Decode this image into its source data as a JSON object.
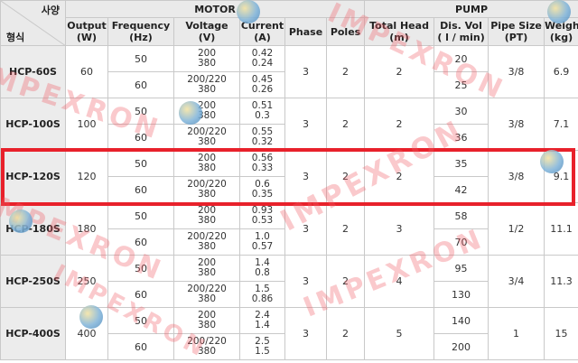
{
  "header": {
    "corner_top": "사양",
    "corner_bottom": "형식",
    "motor_group": "MOTOR",
    "pump_group": "PUMP",
    "output": [
      "Output",
      "(W)"
    ],
    "frequency": [
      "Frequency",
      "(Hz)"
    ],
    "voltage": [
      "Voltage",
      "(V)"
    ],
    "current": [
      "Current",
      "(A)"
    ],
    "phase": "Phase",
    "poles": "Poles",
    "total_head": [
      "Total Head",
      "(m)"
    ],
    "dis_vol": [
      "Dis. Vol",
      "( l / min)"
    ],
    "pipe_size": [
      "Pipe Size",
      "(PT)"
    ],
    "weight": [
      "Weight",
      "(kg)"
    ]
  },
  "rows": [
    {
      "model": "HCP-60S",
      "output": "60",
      "phase": "3",
      "poles": "2",
      "head": "2",
      "pipe": "3/8",
      "weight": "6.9",
      "sub": [
        {
          "hz": "50",
          "v": [
            "200",
            "380"
          ],
          "a": [
            "0.42",
            "0.24"
          ],
          "vol": "20"
        },
        {
          "hz": "60",
          "v": [
            "200/220",
            "380"
          ],
          "a": [
            "0.45",
            "0.26"
          ],
          "vol": "25"
        }
      ]
    },
    {
      "model": "HCP-100S",
      "output": "100",
      "phase": "3",
      "poles": "2",
      "head": "2",
      "pipe": "3/8",
      "weight": "7.1",
      "sub": [
        {
          "hz": "50",
          "v": [
            "200",
            "380"
          ],
          "a": [
            "0.51",
            "0.3"
          ],
          "vol": "30"
        },
        {
          "hz": "60",
          "v": [
            "200/220",
            "380"
          ],
          "a": [
            "0.55",
            "0.32"
          ],
          "vol": "36"
        }
      ]
    },
    {
      "model": "HCP-120S",
      "output": "120",
      "phase": "3",
      "poles": "2",
      "head": "2",
      "pipe": "3/8",
      "weight": "9.1",
      "sub": [
        {
          "hz": "50",
          "v": [
            "200",
            "380"
          ],
          "a": [
            "0.56",
            "0.33"
          ],
          "vol": "35"
        },
        {
          "hz": "60",
          "v": [
            "200/220",
            "380"
          ],
          "a": [
            "0.6",
            "0.35"
          ],
          "vol": "42"
        }
      ]
    },
    {
      "model": "HCP-180S",
      "output": "180",
      "phase": "3",
      "poles": "2",
      "head": "3",
      "pipe": "1/2",
      "weight": "11.1",
      "sub": [
        {
          "hz": "50",
          "v": [
            "200",
            "380"
          ],
          "a": [
            "0.93",
            "0.53"
          ],
          "vol": "58"
        },
        {
          "hz": "60",
          "v": [
            "200/220",
            "380"
          ],
          "a": [
            "1.0",
            "0.57"
          ],
          "vol": "70"
        }
      ]
    },
    {
      "model": "HCP-250S",
      "output": "250",
      "phase": "3",
      "poles": "2",
      "head": "4",
      "pipe": "3/4",
      "weight": "11.3",
      "sub": [
        {
          "hz": "50",
          "v": [
            "200",
            "380"
          ],
          "a": [
            "1.4",
            "0.8"
          ],
          "vol": "95"
        },
        {
          "hz": "60",
          "v": [
            "200/220",
            "380"
          ],
          "a": [
            "1.5",
            "0.86"
          ],
          "vol": "130"
        }
      ]
    },
    {
      "model": "HCP-400S",
      "output": "400",
      "phase": "3",
      "poles": "2",
      "head": "5",
      "pipe": "1",
      "weight": "15",
      "sub": [
        {
          "hz": "50",
          "v": [
            "200",
            "380"
          ],
          "a": [
            "2.4",
            "1.4"
          ],
          "vol": "140"
        },
        {
          "hz": "60",
          "v": [
            "200/220",
            "380"
          ],
          "a": [
            "2.5",
            "1.5"
          ],
          "vol": "200"
        }
      ]
    }
  ],
  "highlighted_model": "HCP-120S",
  "watermark": {
    "text": "IMPEXRON",
    "color": "#f05a64"
  }
}
